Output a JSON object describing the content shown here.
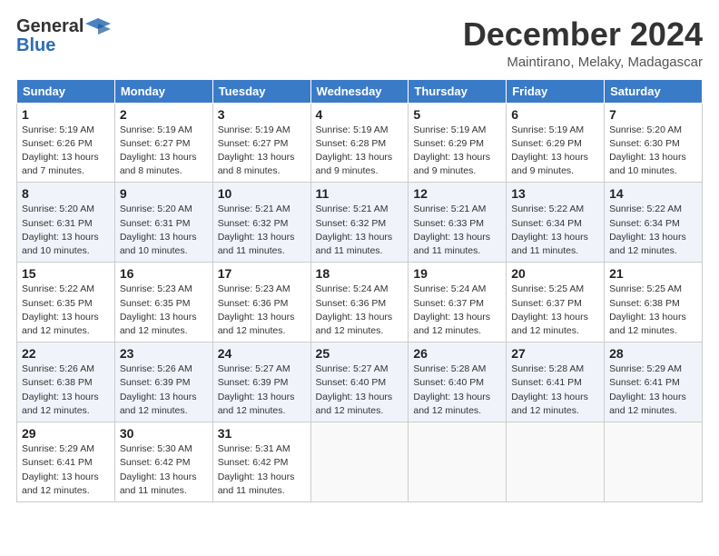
{
  "logo": {
    "general": "General",
    "blue": "Blue"
  },
  "title": {
    "month": "December 2024",
    "location": "Maintirano, Melaky, Madagascar"
  },
  "weekdays": [
    "Sunday",
    "Monday",
    "Tuesday",
    "Wednesday",
    "Thursday",
    "Friday",
    "Saturday"
  ],
  "weeks": [
    [
      {
        "day": 1,
        "sunrise": "5:19 AM",
        "sunset": "6:26 PM",
        "daylight": "13 hours and 7 minutes."
      },
      {
        "day": 2,
        "sunrise": "5:19 AM",
        "sunset": "6:27 PM",
        "daylight": "13 hours and 8 minutes."
      },
      {
        "day": 3,
        "sunrise": "5:19 AM",
        "sunset": "6:27 PM",
        "daylight": "13 hours and 8 minutes."
      },
      {
        "day": 4,
        "sunrise": "5:19 AM",
        "sunset": "6:28 PM",
        "daylight": "13 hours and 9 minutes."
      },
      {
        "day": 5,
        "sunrise": "5:19 AM",
        "sunset": "6:29 PM",
        "daylight": "13 hours and 9 minutes."
      },
      {
        "day": 6,
        "sunrise": "5:19 AM",
        "sunset": "6:29 PM",
        "daylight": "13 hours and 9 minutes."
      },
      {
        "day": 7,
        "sunrise": "5:20 AM",
        "sunset": "6:30 PM",
        "daylight": "13 hours and 10 minutes."
      }
    ],
    [
      {
        "day": 8,
        "sunrise": "5:20 AM",
        "sunset": "6:31 PM",
        "daylight": "13 hours and 10 minutes."
      },
      {
        "day": 9,
        "sunrise": "5:20 AM",
        "sunset": "6:31 PM",
        "daylight": "13 hours and 10 minutes."
      },
      {
        "day": 10,
        "sunrise": "5:21 AM",
        "sunset": "6:32 PM",
        "daylight": "13 hours and 11 minutes."
      },
      {
        "day": 11,
        "sunrise": "5:21 AM",
        "sunset": "6:32 PM",
        "daylight": "13 hours and 11 minutes."
      },
      {
        "day": 12,
        "sunrise": "5:21 AM",
        "sunset": "6:33 PM",
        "daylight": "13 hours and 11 minutes."
      },
      {
        "day": 13,
        "sunrise": "5:22 AM",
        "sunset": "6:34 PM",
        "daylight": "13 hours and 11 minutes."
      },
      {
        "day": 14,
        "sunrise": "5:22 AM",
        "sunset": "6:34 PM",
        "daylight": "13 hours and 12 minutes."
      }
    ],
    [
      {
        "day": 15,
        "sunrise": "5:22 AM",
        "sunset": "6:35 PM",
        "daylight": "13 hours and 12 minutes."
      },
      {
        "day": 16,
        "sunrise": "5:23 AM",
        "sunset": "6:35 PM",
        "daylight": "13 hours and 12 minutes."
      },
      {
        "day": 17,
        "sunrise": "5:23 AM",
        "sunset": "6:36 PM",
        "daylight": "13 hours and 12 minutes."
      },
      {
        "day": 18,
        "sunrise": "5:24 AM",
        "sunset": "6:36 PM",
        "daylight": "13 hours and 12 minutes."
      },
      {
        "day": 19,
        "sunrise": "5:24 AM",
        "sunset": "6:37 PM",
        "daylight": "13 hours and 12 minutes."
      },
      {
        "day": 20,
        "sunrise": "5:25 AM",
        "sunset": "6:37 PM",
        "daylight": "13 hours and 12 minutes."
      },
      {
        "day": 21,
        "sunrise": "5:25 AM",
        "sunset": "6:38 PM",
        "daylight": "13 hours and 12 minutes."
      }
    ],
    [
      {
        "day": 22,
        "sunrise": "5:26 AM",
        "sunset": "6:38 PM",
        "daylight": "13 hours and 12 minutes."
      },
      {
        "day": 23,
        "sunrise": "5:26 AM",
        "sunset": "6:39 PM",
        "daylight": "13 hours and 12 minutes."
      },
      {
        "day": 24,
        "sunrise": "5:27 AM",
        "sunset": "6:39 PM",
        "daylight": "13 hours and 12 minutes."
      },
      {
        "day": 25,
        "sunrise": "5:27 AM",
        "sunset": "6:40 PM",
        "daylight": "13 hours and 12 minutes."
      },
      {
        "day": 26,
        "sunrise": "5:28 AM",
        "sunset": "6:40 PM",
        "daylight": "13 hours and 12 minutes."
      },
      {
        "day": 27,
        "sunrise": "5:28 AM",
        "sunset": "6:41 PM",
        "daylight": "13 hours and 12 minutes."
      },
      {
        "day": 28,
        "sunrise": "5:29 AM",
        "sunset": "6:41 PM",
        "daylight": "13 hours and 12 minutes."
      }
    ],
    [
      {
        "day": 29,
        "sunrise": "5:29 AM",
        "sunset": "6:41 PM",
        "daylight": "13 hours and 12 minutes."
      },
      {
        "day": 30,
        "sunrise": "5:30 AM",
        "sunset": "6:42 PM",
        "daylight": "13 hours and 11 minutes."
      },
      {
        "day": 31,
        "sunrise": "5:31 AM",
        "sunset": "6:42 PM",
        "daylight": "13 hours and 11 minutes."
      },
      null,
      null,
      null,
      null
    ]
  ],
  "labels": {
    "sunrise": "Sunrise:",
    "sunset": "Sunset:",
    "daylight": "Daylight:"
  }
}
